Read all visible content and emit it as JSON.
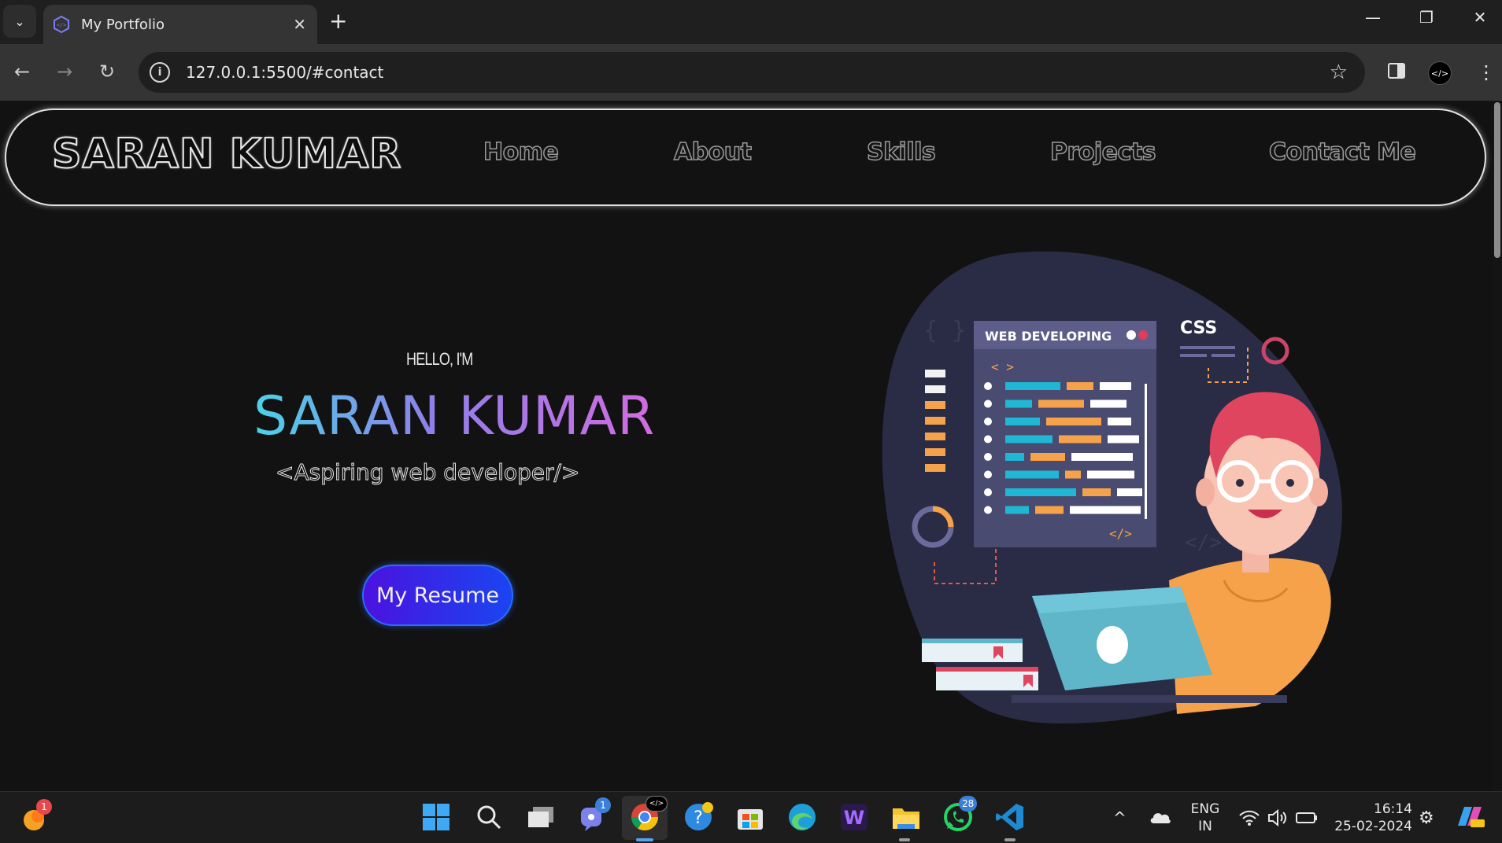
{
  "browser": {
    "tab_title": "My Portfolio",
    "url": "127.0.0.1:5500/#contact"
  },
  "navbar": {
    "brand": "SARAN KUMAR",
    "links": [
      "Home",
      "About",
      "Skills",
      "Projects",
      "Contact Me"
    ]
  },
  "hero": {
    "greeting": "HELLO, I'M",
    "name": "SARAN KUMAR",
    "tagline": "<Aspiring web developer/>",
    "resume_button": "My Resume",
    "illustration": {
      "panel_title": "WEB DEVELOPING",
      "css_label": "CSS",
      "open_tag": "< >",
      "close_tag": "</>"
    }
  },
  "taskbar": {
    "weather_badge": "1",
    "teams_badge": "1",
    "whatsapp_badge": "28",
    "language": "ENG",
    "region": "IN",
    "time": "16:14",
    "date": "25-02-2024",
    "icons": [
      "start-icon",
      "search-icon",
      "task-view-icon",
      "teams-icon",
      "chrome-icon",
      "help-icon",
      "store-icon",
      "edge-icon",
      "w-app-icon",
      "file-explorer-icon",
      "whatsapp-icon",
      "vscode-icon"
    ]
  },
  "colors": {
    "accent_gradient_start": "#4ad3e8",
    "accent_gradient_end": "#d16ce0",
    "button_start": "#4b12e0",
    "button_end": "#1a45f0",
    "page_bg": "#121212",
    "illustration_bg": "#2a2b45"
  }
}
